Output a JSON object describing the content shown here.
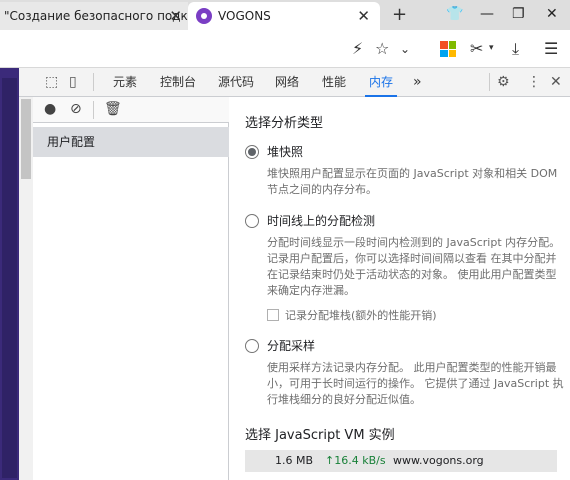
{
  "tabs": [
    {
      "title": "\"Создание безопасного подклю",
      "close": "✕"
    },
    {
      "title": "VOGONS",
      "close": "✕"
    }
  ],
  "new_tab": "+",
  "window_controls": {
    "minimize": "—",
    "maximize": "❐",
    "close": "✕"
  },
  "toolbar_icons": [
    "read-aloud-icon",
    "favorite-star-icon",
    "chevron-down-icon",
    "microsoft-logo-icon",
    "web-capture-icon",
    "downloads-icon",
    "menu-icon"
  ],
  "devtools": {
    "tabs": [
      "元素",
      "控制台",
      "源代码",
      "网络",
      "性能",
      "内存"
    ],
    "active_tab": "内存",
    "more": "»",
    "sidebar_item": "用户配置",
    "heading": "选择分析类型",
    "options": [
      {
        "label": "堆快照",
        "selected": true,
        "desc": "堆快照用户配置显示在页面的 JavaScript 对象和相关 DOM 节点之间的内存分布。"
      },
      {
        "label": "时间线上的分配检测",
        "selected": false,
        "desc": "分配时间线显示一段时间内检测到的 JavaScript 内存分配。 记录用户配置后，你可以选择时间间隔以查看 在其中分配并在记录结束时仍处于活动状态的对象。 使用此用户配置类型来确定内存泄漏。"
      },
      {
        "label": "分配采样",
        "selected": false,
        "desc": "使用采样方法记录内存分配。 此用户配置类型的性能开销最小，可用于长时间运行的操作。 它提供了通过 JavaScript 执行堆栈细分的良好分配近似值。"
      }
    ],
    "checkbox_label": "记录分配堆栈(额外的性能开销)",
    "vm_heading": "选择 JavaScript VM 实例",
    "vm": {
      "size": "1.6 MB",
      "rate": "↑16.4 kB/s",
      "host": "www.vogons.org"
    },
    "colors": {
      "accent": "#1a73e8",
      "rate": "#188038"
    }
  }
}
